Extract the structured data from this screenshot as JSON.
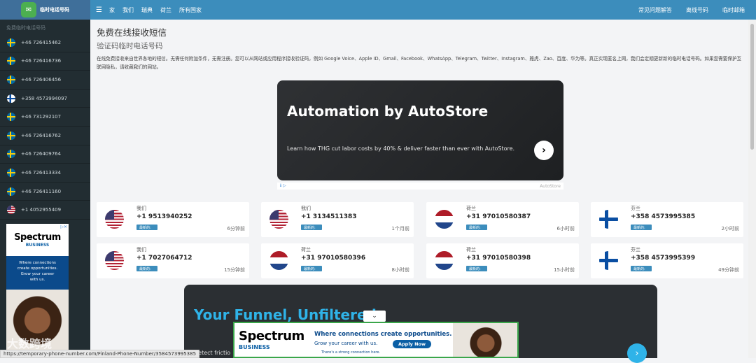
{
  "brand": {
    "title": "临时电话号码"
  },
  "topnav": {
    "menu_icon": "menu-icon",
    "links": [
      "家",
      "我们",
      "瑞典",
      "荷兰",
      "所有国家"
    ],
    "right_links": [
      "常见问题解答",
      "离线号码",
      "临时邮箱"
    ]
  },
  "sidebar": {
    "header": "免费临时电话号码",
    "items": [
      {
        "flag": "se",
        "number": "+46 726415462"
      },
      {
        "flag": "se",
        "number": "+46 726416736"
      },
      {
        "flag": "se",
        "number": "+46 726406456"
      },
      {
        "flag": "fi",
        "number": "+358 4573994097"
      },
      {
        "flag": "se",
        "number": "+46 731292107"
      },
      {
        "flag": "se",
        "number": "+46 726416762"
      },
      {
        "flag": "se",
        "number": "+46 726409764"
      },
      {
        "flag": "se",
        "number": "+46 726413334"
      },
      {
        "flag": "se",
        "number": "+46 726411160"
      },
      {
        "flag": "us",
        "number": "+1 4052955409"
      }
    ],
    "ad": {
      "brand": "Spectrum",
      "sub": "BUSINESS",
      "line1": "Where connections",
      "line2": "create opportunities.",
      "line3": "Grow your career",
      "line4": "with us."
    }
  },
  "main": {
    "title": "免费在线接收短信",
    "subtitle": "验证码临时电话号码",
    "description": "在线免费接收来自世界各地的短信。无需任何附加条件，无需注册。您可以从网站或应用程序接收验证码，例如 Google Voice、Apple ID、Gmail、Facebook、WhatsApp、Telegram、Twitter、Instagram、雅虎、Zao、百度、华为等。真正实现匿名上网，我们会定期更新新的临时电话号码。如果您需要保护互联网隐私，请收藏我们的网站。"
  },
  "banner_ad": {
    "title": "Automation by AutoStore",
    "subtitle": "Learn how THG cut labor costs by 40% & deliver faster than ever with AutoStore.",
    "footer_brand": "AutoStore"
  },
  "cards": [
    {
      "flag": "us",
      "country": "我们",
      "number": "+1 9513940252",
      "badge": "最新的:",
      "time": "6分钟前"
    },
    {
      "flag": "us",
      "country": "我们",
      "number": "+1 3134511383",
      "badge": "最新的:",
      "time": "1个月前"
    },
    {
      "flag": "nl",
      "country": "荷兰",
      "number": "+31 97010580387",
      "badge": "最新的:",
      "time": "6小时前"
    },
    {
      "flag": "fi",
      "country": "芬兰",
      "number": "+358 4573995385",
      "badge": "最新的:",
      "time": "2小时前"
    },
    {
      "flag": "us",
      "country": "我们",
      "number": "+1 7027064712",
      "badge": "最新的:",
      "time": "15分钟前"
    },
    {
      "flag": "nl",
      "country": "荷兰",
      "number": "+31 97010580396",
      "badge": "最新的:",
      "time": "8小时前"
    },
    {
      "flag": "nl",
      "country": "荷兰",
      "number": "+31 97010580398",
      "badge": "最新的:",
      "time": "15小时前"
    },
    {
      "flag": "fi",
      "country": "芬兰",
      "number": "+358 4573995399",
      "badge": "最新的:",
      "time": "49分钟前"
    }
  ],
  "funnel_ad": {
    "title": "Your Funnel, Unfiltered",
    "subtitle": "Detect frictio"
  },
  "bottom_ad": {
    "brand": "Spectrum",
    "sub": "BUSINESS",
    "line1": "Where connections create opportunities.",
    "line2": "Grow your career with us.",
    "apply": "Apply Now",
    "line3": "There's a strong connection here."
  },
  "status_url": "https://temporary-phone-number.com/Finland-Phone-Number/3584573995385",
  "watermark": "大数跨境"
}
